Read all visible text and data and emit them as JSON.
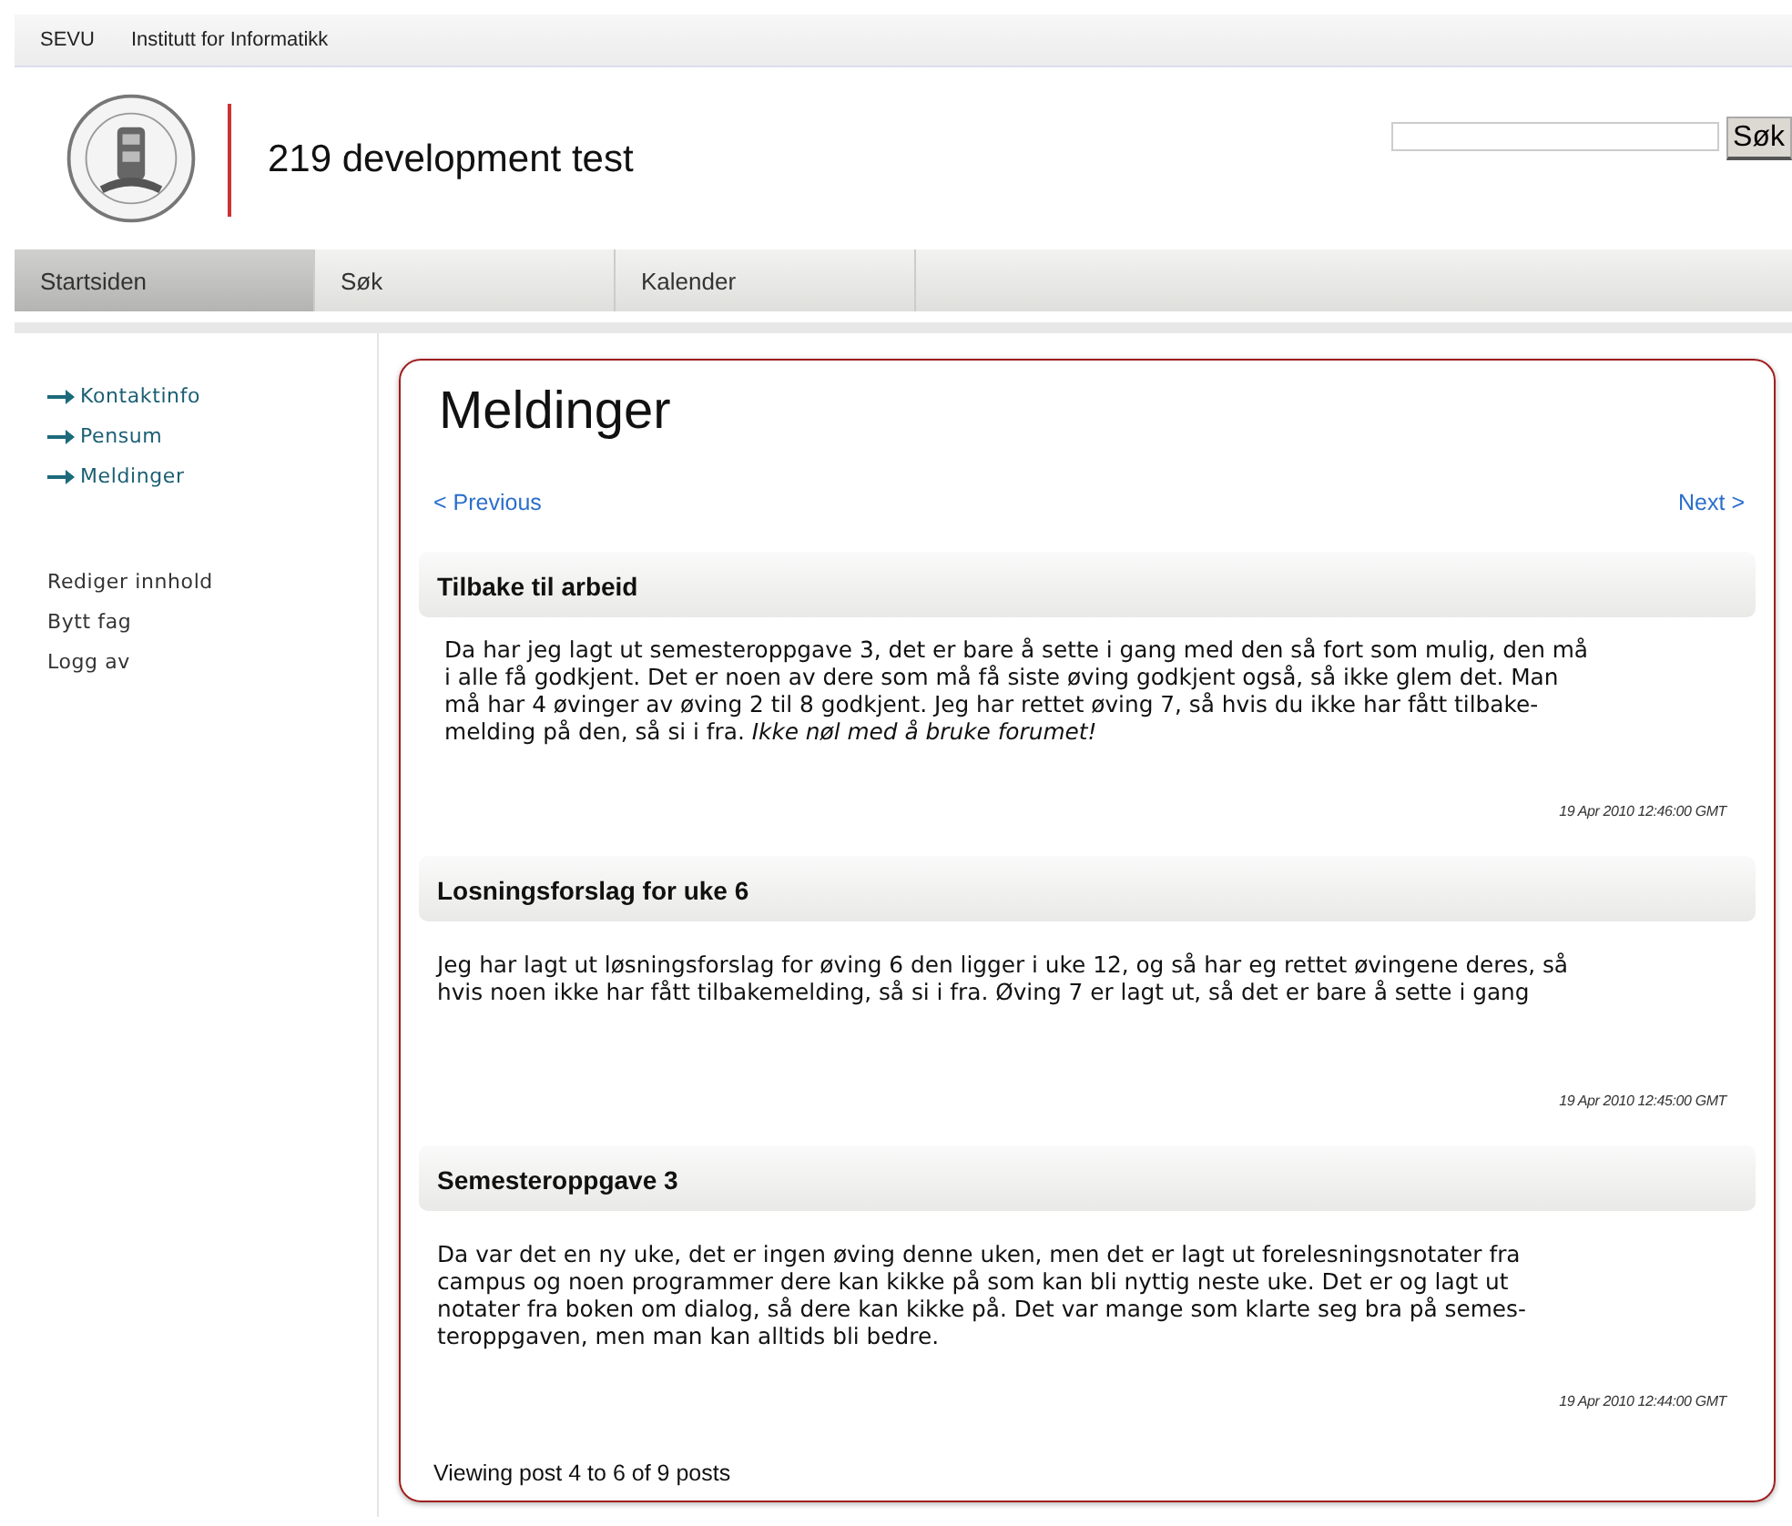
{
  "top_links": [
    "SEVU",
    "Institutt for Informatikk"
  ],
  "site_title": "219 development test",
  "search": {
    "button": "Søk"
  },
  "nav_tabs": [
    {
      "label": "Startsiden",
      "selected": true
    },
    {
      "label": "Søk",
      "selected": false
    },
    {
      "label": "Kalender",
      "selected": false
    }
  ],
  "sidebar": {
    "course_links": [
      "Kontaktinfo",
      "Pensum",
      "Meldinger"
    ],
    "admin_links": [
      "Rediger innhold",
      "Bytt fag",
      "Logg av"
    ]
  },
  "main": {
    "heading": "Meldinger",
    "prev": "< Previous",
    "next": "Next >",
    "posts": [
      {
        "title": "Tilbake til arbeid",
        "lines": [
          "Da har jeg lagt ut semesteroppgave 3, det er bare å sette i gang med den så fort som mulig, den må",
          "i alle få godkjent. Det er noen av dere som må få siste øving godkjent også, så ikke glem det. Man",
          "må har 4 øvinger av øving 2 til 8 godkjent. Jeg har rettet øving 7, så hvis du ikke har fått tilbake-",
          "melding på den, så si i fra. *Ikke nøl med å bruke forumet!*"
        ],
        "date": "19 Apr 2010 12:46:00 GMT"
      },
      {
        "title": "Losningsforslag for uke 6",
        "lines": [
          "Jeg har lagt ut løsningsforslag for øving 6 den ligger i uke 12, og så har eg rettet øvingene deres, så",
          "hvis noen ikke har fått tilbakemelding, så si i fra. Øving 7 er lagt ut, så det er bare å sette i gang"
        ],
        "date": "19 Apr 2010 12:45:00 GMT"
      },
      {
        "title": "Semesteroppgave 3",
        "lines": [
          "Da var det en ny uke, det er ingen øving denne uken, men det er lagt ut forelesningsnotater fra",
          "campus og noen programmer dere kan kikke på som kan bli nyttig neste uke. Det er og lagt ut",
          "notater fra boken om dialog, så dere kan kikke på. Det var mange som klarte seg bra på semes-",
          "teroppgaven, men man kan alltids bli bedre."
        ],
        "date": "19 Apr 2010 12:44:00 GMT"
      }
    ],
    "footer": "Viewing post 4 to 6 of 9 posts"
  }
}
